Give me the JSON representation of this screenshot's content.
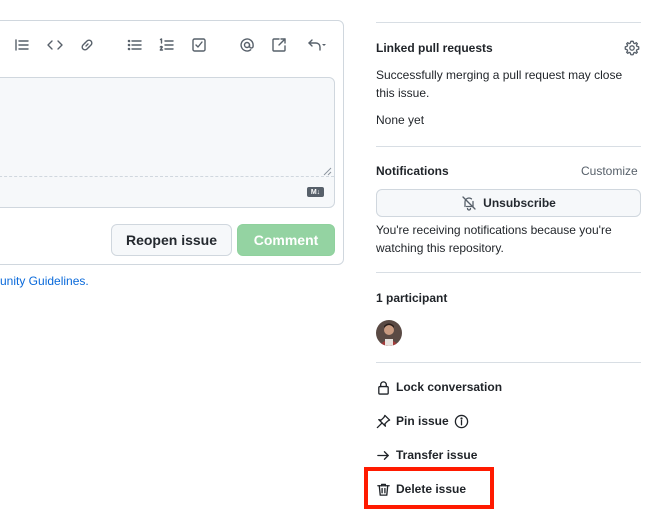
{
  "editor": {
    "reopen_label": "Reopen issue",
    "comment_label": "Comment",
    "markdown_badge": "M↓",
    "guidelines_text": "unity Guidelines."
  },
  "sidebar": {
    "top_cut_text": "── ─── ──",
    "linked_pr": {
      "heading": "Linked pull requests",
      "description": "Successfully merging a pull request may close this issue.",
      "empty": "None yet"
    },
    "notifications": {
      "heading": "Notifications",
      "customize": "Customize",
      "unsubscribe": "Unsubscribe",
      "reason": "You're receiving notifications because you're watching this repository."
    },
    "participants": {
      "heading": "1 participant"
    },
    "actions": {
      "lock": "Lock conversation",
      "pin": "Pin issue",
      "transfer": "Transfer issue",
      "delete": "Delete issue"
    }
  },
  "colors": {
    "highlight": "#ff1a00",
    "comment_button": "#94d3a2",
    "link": "#0969da"
  }
}
